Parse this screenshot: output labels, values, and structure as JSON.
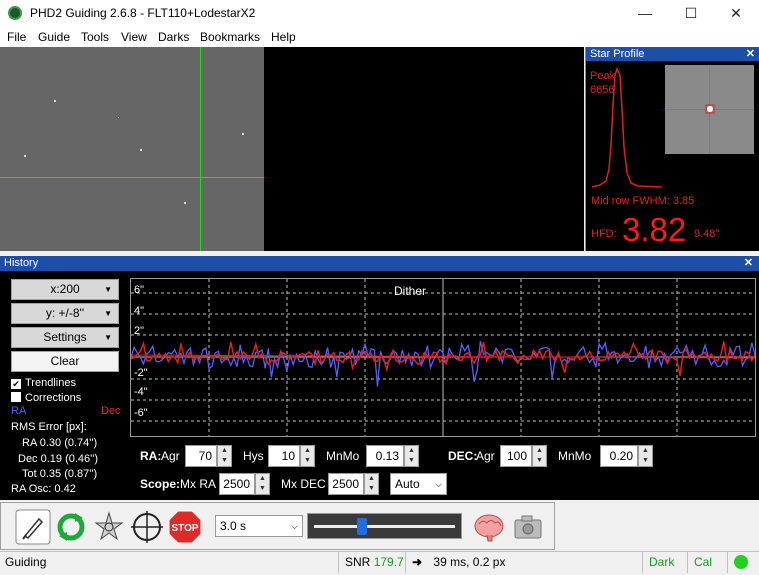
{
  "window": {
    "title": "PHD2 Guiding 2.6.8 - FLT110+LodestarX2",
    "minimize": "—",
    "maximize": "☐",
    "close": "✕"
  },
  "menu": [
    "File",
    "Guide",
    "Tools",
    "View",
    "Darks",
    "Bookmarks",
    "Help"
  ],
  "star_profile": {
    "title": "Star Profile",
    "close": "✕",
    "peak_label": "Peak",
    "peak_value": "6656",
    "fwhm": "Mid row FWHM: 3.85",
    "hfd_label": "HFD:",
    "hfd_value": "3.82",
    "hfd_arcsec": "9.48\""
  },
  "history": {
    "title": "History",
    "close": "✕",
    "x_scale": "x:200",
    "y_scale": "y: +/-8''",
    "settings": "Settings",
    "clear": "Clear",
    "trendlines": "Trendlines",
    "trendlines_checked": true,
    "corrections": "Corrections",
    "corrections_checked": false,
    "legend_ra": "RA",
    "legend_dec": "Dec",
    "rms_title": "RMS Error [px]:",
    "rms_ra": "RA  0.30 (0.74'')",
    "rms_dec": "Dec  0.19 (0.46'')",
    "rms_tot": "Tot  0.35 (0.87'')",
    "ra_osc": "RA Osc: 0.42",
    "dither_label": "Dither",
    "y_ticks": [
      "6\"",
      "4\"",
      "2\"",
      "-2\"",
      "-4\"",
      "-6\""
    ],
    "colors": {
      "ra": "#5b5bff",
      "dec": "#e02020"
    }
  },
  "params": {
    "ra_label": "RA:",
    "agr_label": "Agr",
    "ra_agr": "70",
    "hys_label": "Hys",
    "ra_hys": "10",
    "mnmo_label": "MnMo",
    "ra_mnmo": "0.13",
    "dec_label": "DEC:",
    "dec_agr": "100",
    "dec_mnmo": "0.20",
    "scope_label": "Scope:",
    "mxra_label": "Mx RA",
    "mx_ra": "2500",
    "mxdec_label": "Mx DEC",
    "mx_dec": "2500",
    "dec_mode": "Auto"
  },
  "toolbar": {
    "exposure": "3.0 s",
    "stop": "STOP",
    "gamma_fraction": 0.33
  },
  "status": {
    "state": "Guiding",
    "snr_label": "SNR",
    "snr_value": "179.7",
    "guide_info": "39 ms, 0.2 px",
    "dark": "Dark",
    "cal": "Cal"
  }
}
